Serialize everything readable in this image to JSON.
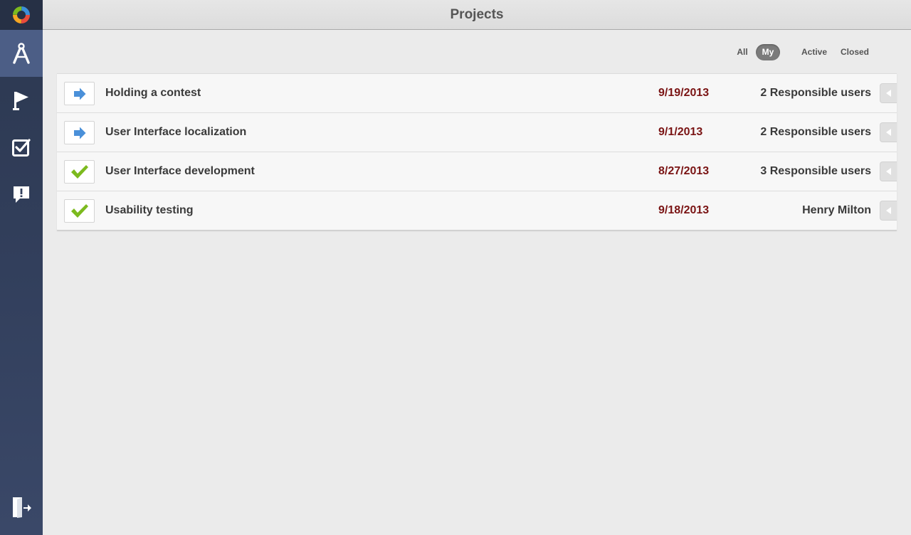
{
  "header": {
    "title": "Projects"
  },
  "sidebar": {
    "logo": "app-logo",
    "items": [
      {
        "name": "projects",
        "icon": "compass-icon",
        "active": true
      },
      {
        "name": "milestones",
        "icon": "flag-icon",
        "active": false
      },
      {
        "name": "tasks",
        "icon": "checkbox-icon",
        "active": false
      },
      {
        "name": "discussions",
        "icon": "alert-bubble-icon",
        "active": false
      }
    ],
    "logout": {
      "icon": "exit-door-icon"
    }
  },
  "filters": {
    "all_label": "All",
    "my_label": "My",
    "active_label": "Active",
    "closed_label": "Closed",
    "selected": "My"
  },
  "projects": [
    {
      "title": "Holding a contest",
      "date": "9/19/2013",
      "responsible": "2 Responsible users",
      "status": "active",
      "icon": "arrow-right-icon"
    },
    {
      "title": "User Interface localization",
      "date": "9/1/2013",
      "responsible": "2 Responsible users",
      "status": "active",
      "icon": "arrow-right-icon"
    },
    {
      "title": "User Interface development",
      "date": "8/27/2013",
      "responsible": "3 Responsible users",
      "status": "closed",
      "icon": "checkmark-icon"
    },
    {
      "title": "Usability testing",
      "date": "9/18/2013",
      "responsible": "Henry Milton",
      "status": "closed",
      "icon": "checkmark-icon"
    }
  ],
  "colors": {
    "date": "#7a1414",
    "arrow": "#4a90d9",
    "check": "#7cba1e",
    "sidebar_active": "#4c5e86"
  }
}
